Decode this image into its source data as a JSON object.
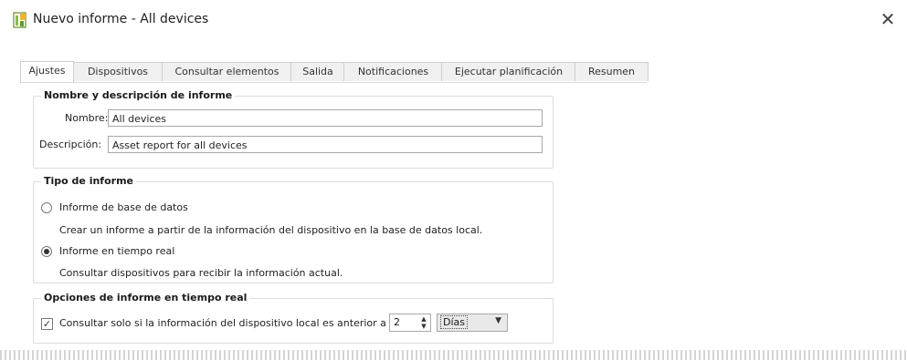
{
  "window": {
    "title": "Nuevo informe - All devices",
    "close_icon": "close-icon",
    "app_icon": "report-icon"
  },
  "tabs": [
    {
      "label": "Ajustes",
      "active": true
    },
    {
      "label": "Dispositivos",
      "active": false
    },
    {
      "label": "Consultar elementos",
      "active": false
    },
    {
      "label": "Salida",
      "active": false
    },
    {
      "label": "Notificaciones",
      "active": false
    },
    {
      "label": "Ejecutar planificación",
      "active": false
    },
    {
      "label": "Resumen",
      "active": false
    }
  ],
  "name_group": {
    "title": "Nombre y descripción de informe",
    "name_label": "Nombre:",
    "name_value": "All devices",
    "description_label": "Descripción:",
    "description_value": "Asset report for all devices"
  },
  "type_group": {
    "title": "Tipo de informe",
    "db_option": "Informe de base de datos",
    "db_help": "Crear un informe a partir de la información del dispositivo en la base de datos local.",
    "realtime_option": "Informe en tiempo real",
    "realtime_help": "Consultar dispositivos para recibir la información actual.",
    "selected": "realtime"
  },
  "realtime_group": {
    "title": "Opciones de informe en tiempo real",
    "checkbox_label": "Consultar solo si la información del dispositivo local es anterior a",
    "checked": true,
    "spin_value": "2",
    "unit_value": "Días"
  }
}
